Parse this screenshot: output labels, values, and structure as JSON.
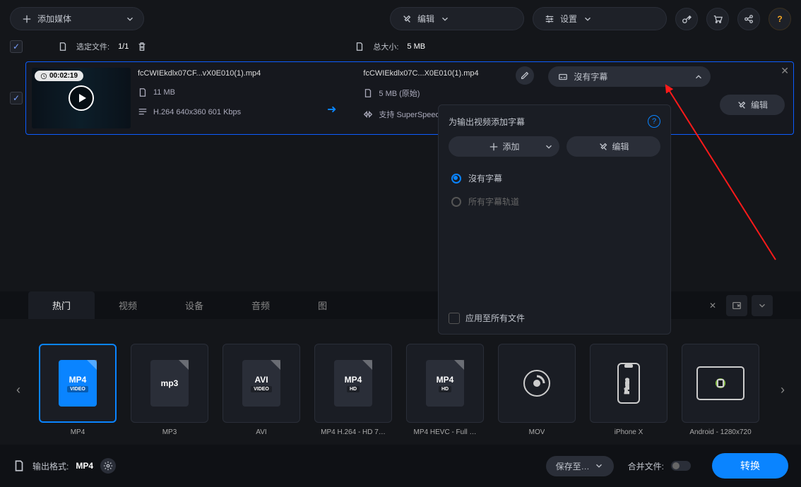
{
  "toolbar": {
    "add_media": "添加媒体",
    "edit": "编辑",
    "settings": "设置"
  },
  "row2": {
    "selected_files": "选定文件:",
    "selected_count": "1/1",
    "total_size_label": "总大小:",
    "total_size": "5 MB"
  },
  "file": {
    "duration": "00:02:19",
    "name_in": "fcCWIEkdlx07CF...vX0E010(1).mp4",
    "size_in": "11 MB",
    "codec": "H.264 640x360 601 Kbps",
    "name_out": "fcCWIEkdlx07C...X0E010(1).mp4",
    "size_out": "5 MB (原始)",
    "superspeed": "支持 SuperSpeed 转",
    "subtitle_sel": "沒有字幕",
    "edit_btn": "编辑"
  },
  "popup": {
    "title": "为输出视频添加字幕",
    "add": "添加",
    "edit": "编辑",
    "opt1": "沒有字幕",
    "opt2": "所有字幕轨道",
    "apply_all": "应用至所有文件"
  },
  "tabs": {
    "hot": "热门",
    "video": "视频",
    "device": "设备",
    "audio": "音频",
    "image": "图"
  },
  "formats": [
    {
      "label": "MP4",
      "big": "MP4",
      "sub": "VIDEO",
      "blue": true
    },
    {
      "label": "MP3",
      "big": "mp3",
      "sub": ""
    },
    {
      "label": "AVI",
      "big": "AVI",
      "sub": "VIDEO"
    },
    {
      "label": "MP4 H.264 - HD 7…",
      "big": "MP4",
      "sub": "HD"
    },
    {
      "label": "MP4 HEVC - Full …",
      "big": "MP4",
      "sub": "HD"
    },
    {
      "label": "MOV",
      "big": "",
      "sub": "",
      "mov": true
    },
    {
      "label": "iPhone X",
      "big": "",
      "sub": "",
      "phone": true
    },
    {
      "label": "Android - 1280x720",
      "big": "",
      "sub": "",
      "tablet": true
    }
  ],
  "bottom": {
    "out_label": "输出格式:",
    "out_fmt": "MP4",
    "save_to": "保存至…",
    "merge": "合并文件:",
    "convert": "转换"
  }
}
